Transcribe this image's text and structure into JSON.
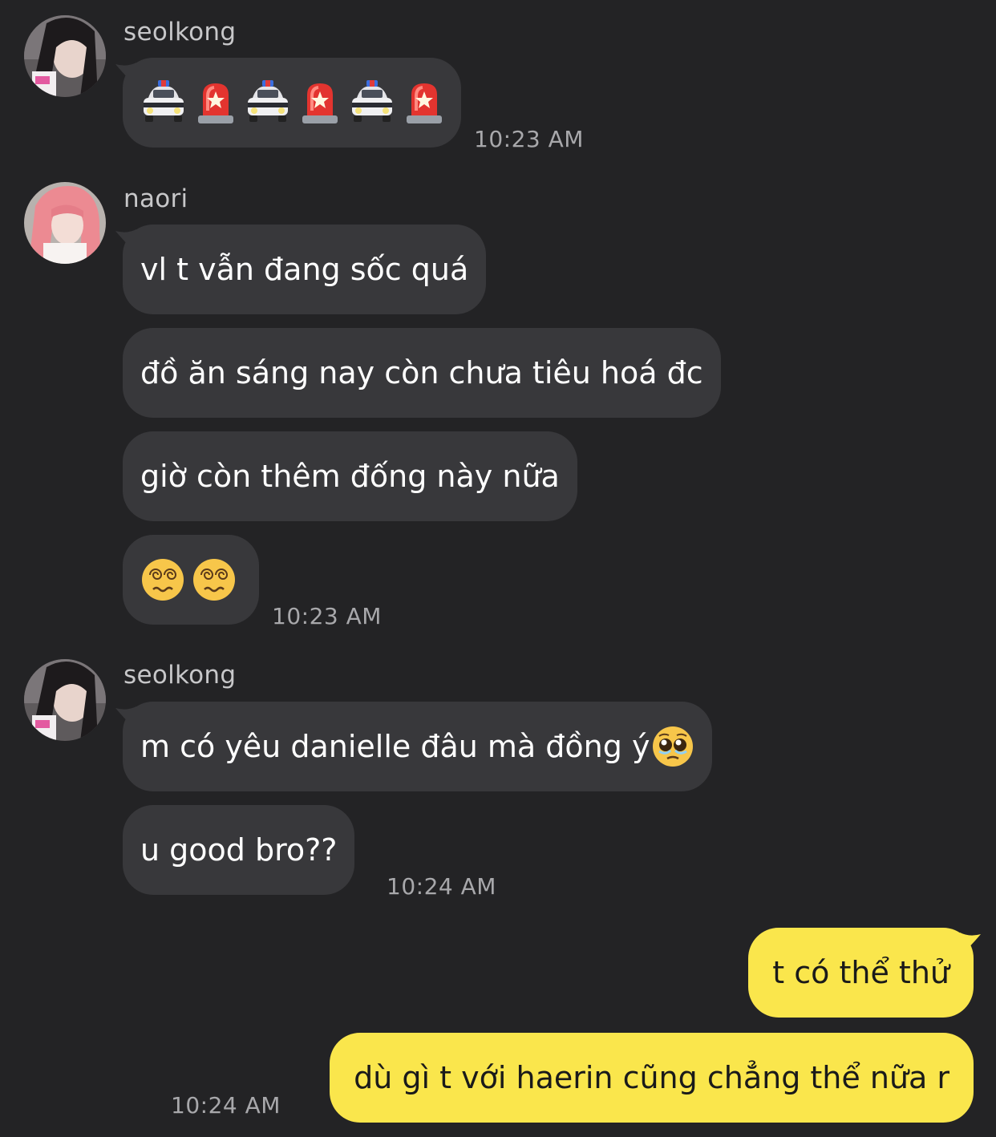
{
  "conversation": {
    "groups": [
      {
        "sender": "seolkong",
        "messages": [
          {
            "type": "emoji",
            "emojis": [
              "police-car",
              "police-light",
              "police-car",
              "police-light",
              "police-car",
              "police-light"
            ]
          }
        ],
        "time": "10:23 AM"
      },
      {
        "sender": "naori",
        "messages": [
          {
            "type": "text",
            "text": "vl t vẫn đang sốc quá"
          },
          {
            "type": "text",
            "text": "đồ ăn sáng nay còn chưa tiêu hoá đc"
          },
          {
            "type": "text",
            "text": "giờ còn thêm đống này nữa"
          },
          {
            "type": "emoji",
            "emojis": [
              "dizzy-face",
              "dizzy-face"
            ]
          }
        ],
        "time": "10:23 AM"
      },
      {
        "sender": "seolkong",
        "messages": [
          {
            "type": "text",
            "text": "m có yêu danielle đâu mà đồng ý",
            "trailing_emoji": "pleading-face"
          },
          {
            "type": "text",
            "text": "u good bro??"
          }
        ],
        "time": "10:24 AM"
      }
    ],
    "outgoing": {
      "messages": [
        {
          "type": "text",
          "text": "t có thể thử"
        },
        {
          "type": "text",
          "text": "dù gì t với haerin cũng chẳng thể nữa r"
        }
      ],
      "time": "10:24 AM"
    }
  },
  "colors": {
    "background": "#232325",
    "incoming_bubble": "#38383b",
    "outgoing_bubble": "#fae64c",
    "timestamp": "#a8a8ab"
  }
}
